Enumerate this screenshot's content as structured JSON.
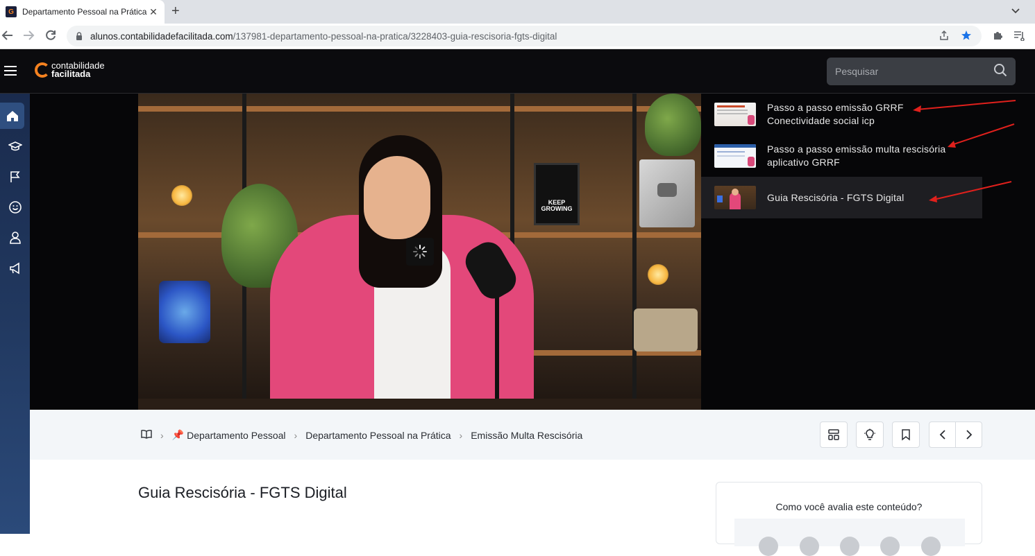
{
  "browser": {
    "tab_title": "Departamento Pessoal na Prática",
    "favicon_letter": "G",
    "url_host": "alunos.contabilidadefacilitada.com",
    "url_path": "/137981-departamento-pessoal-na-pratica/3228403-guia-rescisoria-fgts-digital"
  },
  "header": {
    "logo_line1": "contabilidade",
    "logo_line2": "facilitada",
    "search_placeholder": "Pesquisar"
  },
  "video": {
    "poster_text": "KEEP GROWING"
  },
  "playlist": [
    {
      "line1": "Passo a passo emissão GRRF",
      "line2": "Conectividade social icp",
      "active": false
    },
    {
      "line1": "Passo a passo emissão multa rescisória",
      "line2": "aplicativo GRRF",
      "active": false
    },
    {
      "line1": "Guia Rescisória - FGTS Digital",
      "line2": "",
      "active": true
    }
  ],
  "breadcrumb": {
    "items": [
      "Departamento Pessoal",
      "Departamento Pessoal na Prática",
      "Emissão Multa Rescisória"
    ]
  },
  "lesson": {
    "title": "Guia Rescisória - FGTS Digital"
  },
  "rating": {
    "question": "Como você avalia este conteúdo?"
  },
  "colors": {
    "brand_orange": "#f58220",
    "annotation_red": "#e0201c",
    "sidebar_blue": "#21385f"
  }
}
